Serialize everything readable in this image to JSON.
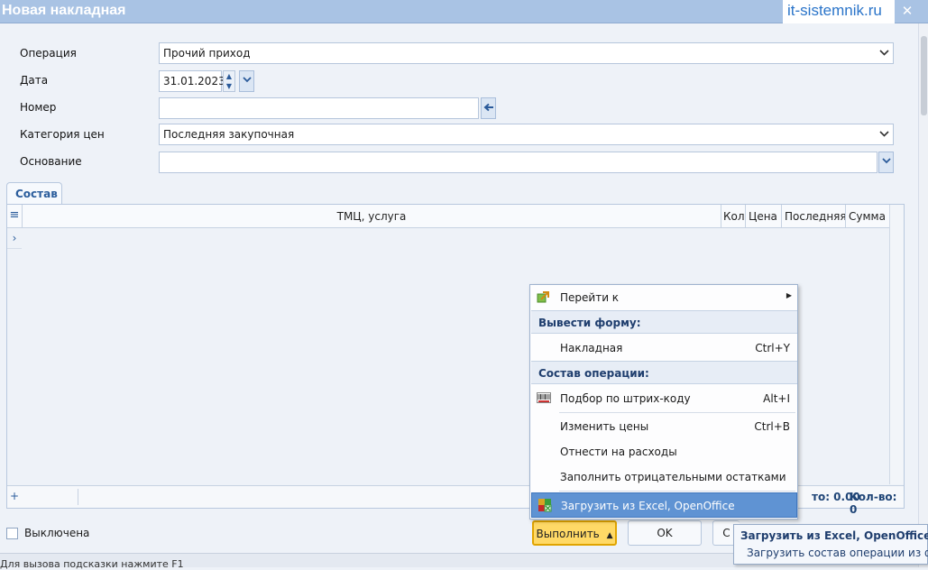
{
  "window": {
    "title": "Новая накладная",
    "watermark": "it-sistemnik.ru",
    "close_glyph": "✕"
  },
  "form": {
    "operation_label": "Операция",
    "operation_value": "Прочий приход",
    "date_label": "Дата",
    "date_value": "31.01.2023",
    "number_label": "Номер",
    "number_value": "",
    "price_category_label": "Категория цен",
    "price_category_value": "Последняя закупочная",
    "basis_label": "Основание",
    "basis_value": ""
  },
  "tabs": [
    {
      "label": "Состав"
    }
  ],
  "table": {
    "columns": [
      "ТМЦ, услуга",
      "Кол",
      "Цена",
      "Последняя",
      "Сумма"
    ],
    "rows": [],
    "footer": {
      "add_glyph": "+",
      "total_sum": "то: 0.00",
      "total_qty": "Кол-во: 0"
    }
  },
  "checkbox": {
    "label": "Выключена",
    "checked": false
  },
  "buttons": {
    "run": "Выполнить",
    "ok": "OK",
    "third": "С"
  },
  "status": {
    "text": "Для вызова подсказки нажмите F1"
  },
  "context_menu": {
    "items": [
      {
        "type": "item",
        "label": "Перейти к",
        "shortcut": "",
        "icon": "goto-icon",
        "submenu": true
      },
      {
        "type": "header",
        "label": "Вывести форму:"
      },
      {
        "type": "item",
        "label": "Накладная",
        "shortcut": "Ctrl+Y"
      },
      {
        "type": "header",
        "label": "Состав операции:"
      },
      {
        "type": "item",
        "label": "Подбор по штрих-коду",
        "shortcut": "Alt+I",
        "icon": "barcode-icon"
      },
      {
        "type": "item",
        "label": "Изменить цены",
        "shortcut": "Ctrl+B"
      },
      {
        "type": "item",
        "label": "Отнести на расходы",
        "shortcut": ""
      },
      {
        "type": "item",
        "label": "Заполнить отрицательными остатками",
        "shortcut": ""
      },
      {
        "type": "item",
        "label": "Загрузить из Excel, OpenOffice",
        "shortcut": "",
        "icon": "excel-icon",
        "selected": true
      }
    ]
  },
  "tooltip": {
    "title": "Загрузить из Excel, OpenOffice",
    "body": "Загрузить состав операции из файла"
  },
  "colors": {
    "titlebar": "#a9c3e4",
    "accent": "#2b5d9c",
    "run_button": "#ffd966",
    "menu_selected": "#5f93d3"
  }
}
